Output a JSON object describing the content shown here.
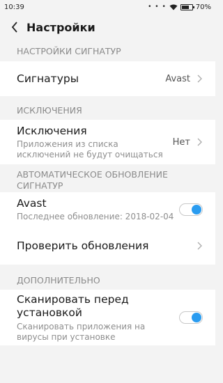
{
  "status": {
    "time": "10:39",
    "battery_text": "70%",
    "battery_level": 0.7
  },
  "header": {
    "title": "Настройки"
  },
  "sections": {
    "signatures": {
      "header": "НАСТРОЙКИ СИГНАТУР",
      "item_title": "Сигнатуры",
      "item_value": "Avast"
    },
    "exclusions": {
      "header": "ИСКЛЮЧЕНИЯ",
      "item_title": "Исключения",
      "item_subtitle_line1": "Приложения из списка",
      "item_subtitle_line2": "исключений не будут очищаться",
      "item_value": "Нет"
    },
    "auto_update": {
      "header_line1": "АВТОМАТИЧЕСКОЕ ОБНОВЛЕНИЕ",
      "header_line2": "СИГНАТУР",
      "avast_title": "Avast",
      "avast_subtitle": "Последнее обновление: 2018-02-04",
      "avast_toggle_on": true,
      "check_updates_title": "Проверить обновления"
    },
    "additional": {
      "header": "ДОПОЛНИТЕЛЬНО",
      "scan_title_line1": "Сканировать перед",
      "scan_title_line2": "установкой",
      "scan_subtitle_line1": "Сканировать приложения на",
      "scan_subtitle_line2": "вирусы при установке",
      "scan_toggle_on": true
    }
  },
  "colors": {
    "accent": "#2a9cf0",
    "background": "#f3f3f3",
    "card": "#ffffff",
    "secondary_text": "#8e8e8e"
  },
  "icons": {
    "back": "chevron-left-icon",
    "row_arrow": "chevron-right-icon",
    "signal": "signal-dots-icon",
    "wifi": "wifi-icon",
    "battery": "battery-icon"
  }
}
